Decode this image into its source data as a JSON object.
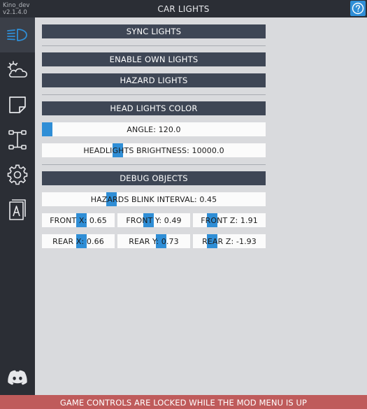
{
  "app": {
    "version_user": "Kino_dev",
    "version_number": "v2.1.4.0",
    "title": "CAR LIGHTS",
    "help_icon": "question-circle-icon"
  },
  "sidebar": {
    "tabs": [
      {
        "name": "lights",
        "icon": "headlight-icon",
        "active": true
      },
      {
        "name": "weather",
        "icon": "sun-cloud-icon",
        "active": false
      },
      {
        "name": "notes",
        "icon": "sticky-note-icon",
        "active": false
      },
      {
        "name": "chassis",
        "icon": "axle-icon",
        "active": false
      },
      {
        "name": "settings",
        "icon": "gear-icon",
        "active": false
      },
      {
        "name": "text",
        "icon": "letter-a-icon",
        "active": false
      },
      {
        "name": "discord",
        "icon": "discord-icon",
        "active": false
      }
    ]
  },
  "controls": {
    "sync_lights": "SYNC LIGHTS",
    "enable_own_lights": "ENABLE OWN LIGHTS",
    "hazard_lights": "HAZARD LIGHTS",
    "head_lights_color": "HEAD LIGHTS COLOR",
    "angle": {
      "label": "ANGLE: 120.0",
      "value": 120.0,
      "fraction": 0.0
    },
    "headlights_brightness": {
      "label": "HEADLIGHTS BRIGHTNESS: 10000.0",
      "value": 10000.0,
      "fraction": 0.33
    },
    "debug_objects": "DEBUG OBJECTS",
    "hazards_blink_interval": {
      "label": "HAZARDS BLINK INTERVAL: 0.45",
      "value": 0.45,
      "fraction": 0.3
    },
    "front_x": {
      "label": "FRONT X: 0.65",
      "value": 0.65,
      "fraction": 0.55
    },
    "front_y": {
      "label": "FRONT Y: 0.49",
      "value": 0.49,
      "fraction": 0.42
    },
    "front_z": {
      "label": "FRONT Z: 1.91",
      "value": 1.91,
      "fraction": 0.22
    },
    "rear_x": {
      "label": "REAR X: 0.66",
      "value": 0.66,
      "fraction": 0.55
    },
    "rear_y": {
      "label": "REAR Y: 0.73",
      "value": 0.73,
      "fraction": 0.62
    },
    "rear_z": {
      "label": "REAR Z: -1.93",
      "value": -1.93,
      "fraction": 0.22
    }
  },
  "footer": {
    "message": "GAME CONTROLS ARE LOCKED WHILE THE MOD MENU IS UP"
  },
  "colors": {
    "accent": "#2f8ed6",
    "button": "#3e4655",
    "sidebar": "#2b2e35",
    "footer": "#bf5b5b"
  }
}
